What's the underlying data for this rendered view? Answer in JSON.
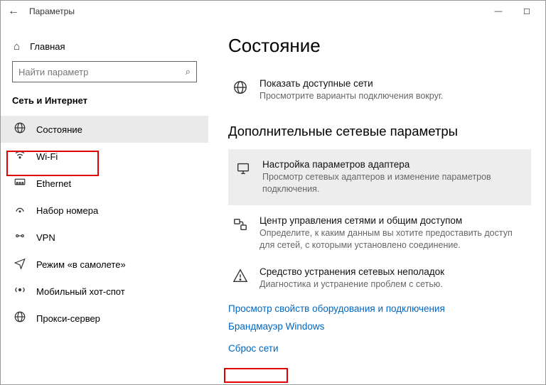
{
  "titlebar": {
    "title": "Параметры"
  },
  "sidebar": {
    "home": "Главная",
    "search_placeholder": "Найти параметр",
    "section": "Сеть и Интернет",
    "items": [
      {
        "label": "Состояние"
      },
      {
        "label": "Wi-Fi"
      },
      {
        "label": "Ethernet"
      },
      {
        "label": "Набор номера"
      },
      {
        "label": "VPN"
      },
      {
        "label": "Режим «в самолете»"
      },
      {
        "label": "Мобильный хот-спот"
      },
      {
        "label": "Прокси-сервер"
      }
    ]
  },
  "content": {
    "title": "Состояние",
    "show_networks": {
      "title": "Показать доступные сети",
      "sub": "Просмотрите варианты подключения вокруг."
    },
    "advanced_heading": "Дополнительные сетевые параметры",
    "adapter": {
      "title": "Настройка параметров адаптера",
      "sub": "Просмотр сетевых адаптеров и изменение параметров подключения."
    },
    "sharing": {
      "title": "Центр управления сетями и общим доступом",
      "sub": "Определите, к каким данным вы хотите предоставить доступ для сетей, с которыми установлено соединение."
    },
    "troubleshoot": {
      "title": "Средство устранения сетевых неполадок",
      "sub": "Диагностика и устранение проблем с сетью."
    },
    "link_hw": "Просмотр свойств оборудования и подключения",
    "link_fw": "Брандмауэр Windows",
    "link_reset": "Сброс сети"
  }
}
